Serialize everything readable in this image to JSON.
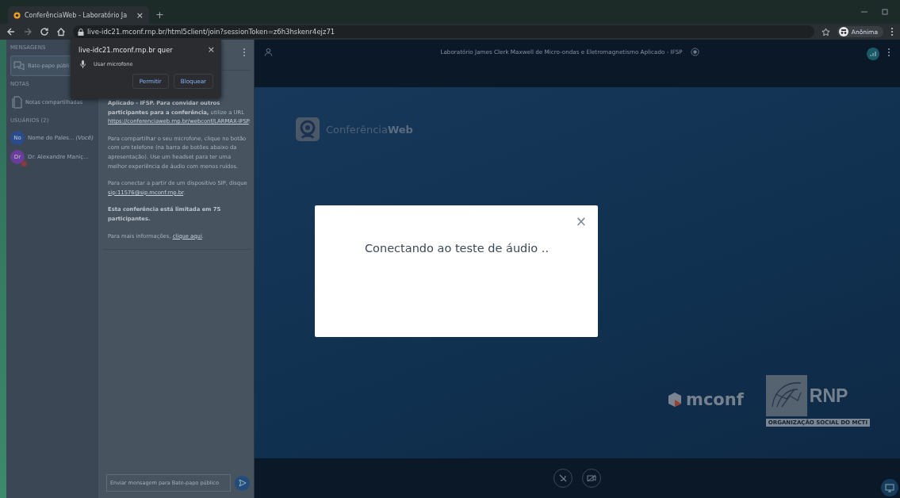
{
  "browser": {
    "tab": {
      "title": "ConferênciaWeb - Laboratório Ja",
      "close": "×",
      "selected": true
    },
    "new_tab": "+",
    "url": "live-idc21.mconf.rnp.br/html5client/join?sessionToken=z6h3hskenr4ejz71",
    "profile": "Anônima"
  },
  "permission_popup": {
    "title": "live-idc21.mconf.rnp.br quer",
    "close": "×",
    "request": "Usar microfone",
    "buttons": [
      "Permitir",
      "Bloquear"
    ]
  },
  "sidebar": {
    "messages_title": "MENSAGENS",
    "chats": [
      {
        "label": "Bate-papo públi",
        "selected": true
      }
    ],
    "notes_title": "NOTAS",
    "notes": [
      {
        "label": "Notas compartilhadas",
        "selected": false
      }
    ],
    "users_title": "USUÁRIOS (2)",
    "users": [
      {
        "initials": "No",
        "name": "Nome do Pales...",
        "suffix": "(Você)",
        "color": "#2b4c8c",
        "muted": false
      },
      {
        "initials": "Dr",
        "name": "Dr. Alexandre Maniç...",
        "color": "#6a3d9a",
        "muted": true
      }
    ]
  },
  "chat": {
    "paragraphs": [
      {
        "parts": [
          {
            "text": "**Aplicado - IFSP. Para convidar outros participantes para a conferência,** utilize a URL",
            "link": false
          },
          {
            "text": "https://conferenciaweb.rnp.br/webconf/LARMAX-IFSP",
            "link": true
          },
          {
            "text": ".",
            "link": false
          }
        ]
      },
      {
        "parts": [
          {
            "text": "Para compartilhar o seu microfone, clique no botão com um telefone (na barra de botões abaixo da apresentação). Use um headset para ter uma melhor experiência de áudio com menos ruídos.",
            "link": false
          }
        ]
      },
      {
        "parts": [
          {
            "text": "Para conectar a partir de um dispositivo SIP, disque",
            "link": false
          },
          {
            "text": "sip:11576@sip.mconf.rnp.br",
            "link": true
          },
          {
            "text": ".",
            "link": false
          }
        ]
      },
      {
        "parts": [
          {
            "text": "**Esta conferência está limitada em 75 participantes.**",
            "link": false
          }
        ]
      },
      {
        "parts": [
          {
            "text": "Para mais informações,",
            "link": false
          },
          {
            "text": "clique aqui",
            "link": true
          },
          {
            "text": ".",
            "link": false
          }
        ]
      }
    ],
    "input": {
      "placeholder": "Enviar mensagem para Bate-papo público"
    }
  },
  "meeting": {
    "title": "Laboratório James Clerk Maxwell de Micro-ondas e Eletromagnetismo Aplicado - IFSP",
    "logo": "Conferência**Web**",
    "mconf": "mconf",
    "rnp": "RNP",
    "rnp_tagline": "ORGANIZAÇÃO SOCIAL DO MCTI"
  },
  "modal": {
    "message": "Conectando ao teste de áudio ..",
    "close": "×"
  }
}
